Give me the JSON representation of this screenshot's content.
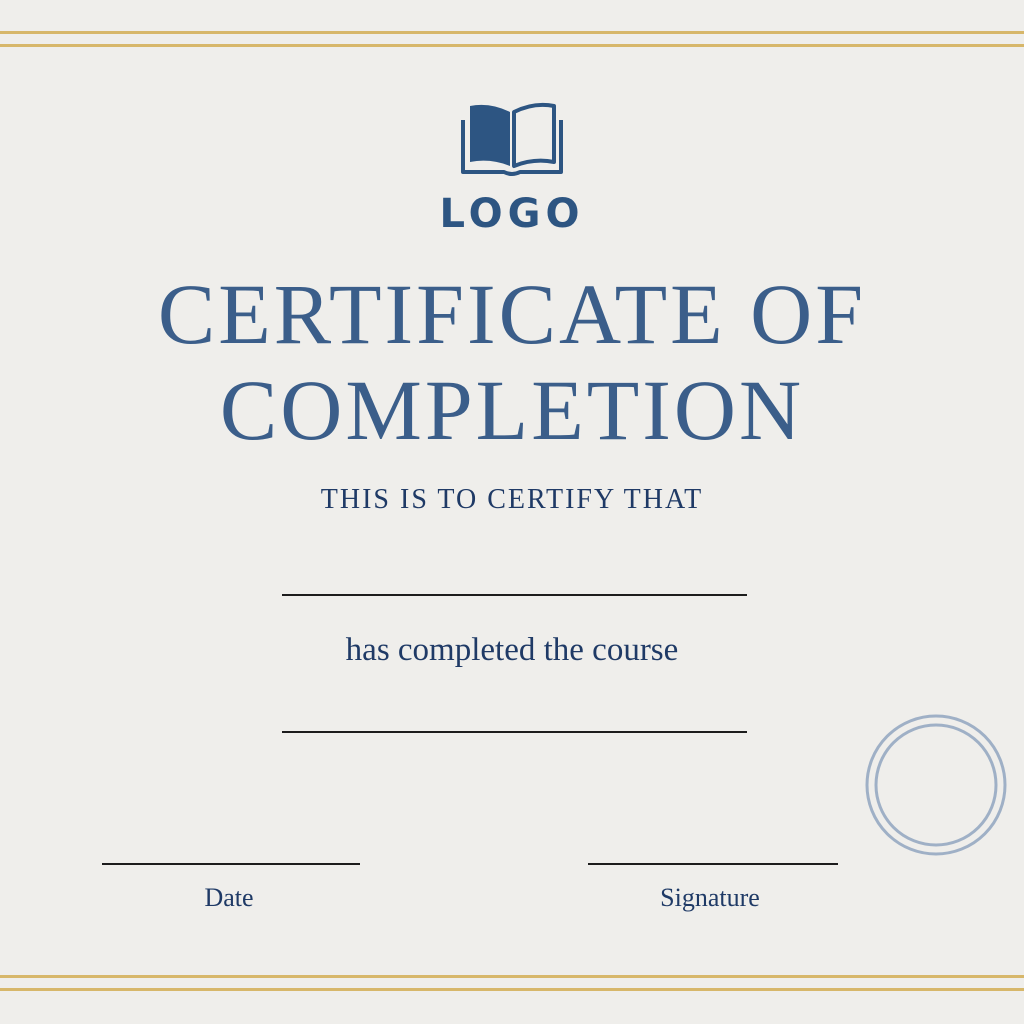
{
  "logo": {
    "icon": "open-book-icon",
    "text": "LOGO"
  },
  "title": {
    "line1": "CERTIFICATE OF",
    "line2": "COMPLETION"
  },
  "certify_text": "THIS IS TO CERTIFY THAT",
  "completed_text": "has completed the course",
  "footer": {
    "date_label": "Date",
    "signature_label": "Signature"
  },
  "colors": {
    "background": "#efeeeb",
    "border_gold": "#d7b76a",
    "primary_blue": "#3b5e8a",
    "text_navy": "#1f3a66",
    "seal_gray_blue": "#9fb0c6"
  }
}
